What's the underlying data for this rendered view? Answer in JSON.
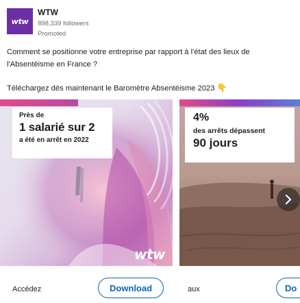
{
  "post": {
    "company": "WTW",
    "logo_text": "wtw",
    "followers": "898,339 followers",
    "promoted": "Promoted",
    "text_line1": "Comment se positionne votre entreprise par rapport à l'état des lieux de",
    "text_line2": "l'Absentéisme en France ?",
    "cta_text": "Téléchargez dès maintenant le Baromètre Absentéisme 2023",
    "hand_icon": "👇"
  },
  "cards": [
    {
      "stat_small_top": "Près de",
      "stat_big": "1 salarié sur 2",
      "stat_small_bottom": "a été en arrêt en 2022",
      "brand_mark": "wtw",
      "label": "Accédez",
      "button": "Download"
    },
    {
      "stat_pct": "4%",
      "stat_middle": "des arrêts dépassent",
      "stat_big": "90 jours",
      "label": "aux",
      "button": "Do"
    }
  ],
  "colors": {
    "brand": "#6b2fa3",
    "link": "#0a66c2",
    "band_pink": "#e34a8a",
    "band_purple": "#8a3fc9"
  },
  "icons": {
    "next": "chevron-right-icon",
    "hand": "pointing-down-icon"
  }
}
